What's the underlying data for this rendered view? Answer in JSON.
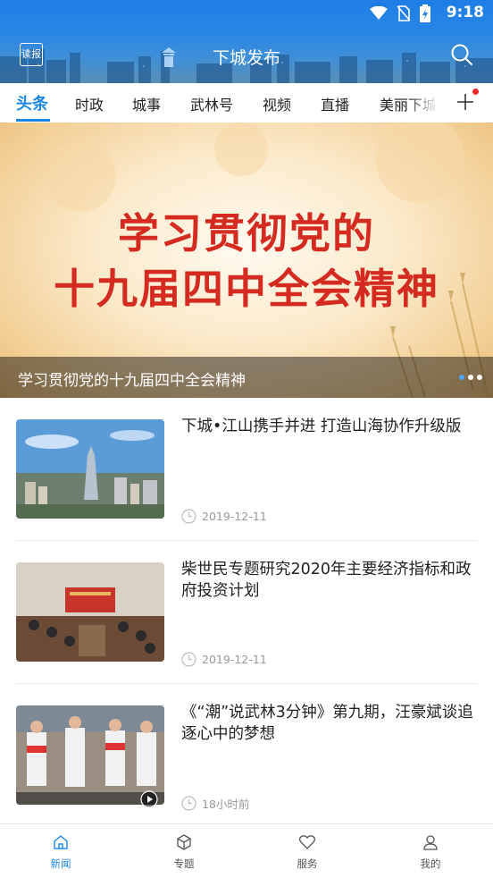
{
  "status": {
    "time": "9:18"
  },
  "header": {
    "read_label": "读报",
    "title": "下城发布"
  },
  "tabs": [
    {
      "label": "头条",
      "active": true
    },
    {
      "label": "时政"
    },
    {
      "label": "城事"
    },
    {
      "label": "武林号"
    },
    {
      "label": "视频"
    },
    {
      "label": "直播"
    },
    {
      "label": "美丽下城"
    }
  ],
  "banner": {
    "headline_line1": "学习贯彻党的",
    "headline_line2": "十九届四中全会精神",
    "caption": "学习贯彻党的十九届四中全会精神"
  },
  "news": [
    {
      "title": "下城•江山携手并进 打造山海协作升级版",
      "time": "2019-12-11"
    },
    {
      "title": "柴世民专题研究2020年主要经济指标和政府投资计划",
      "time": "2019-12-11"
    },
    {
      "title": "《“潮”说武林3分钟》第九期，汪豪斌谈追逐心中的梦想",
      "time": "18小时前"
    }
  ],
  "bottom_nav": [
    {
      "label": "新闻",
      "icon": "home-icon",
      "active": true
    },
    {
      "label": "专题",
      "icon": "cube-icon"
    },
    {
      "label": "服务",
      "icon": "heart-icon"
    },
    {
      "label": "我的",
      "icon": "user-icon"
    }
  ],
  "colors": {
    "accent": "#1e88e5",
    "header": "#2a86e6",
    "headline_red": "#d42a20",
    "notification": "#f02a2a"
  }
}
